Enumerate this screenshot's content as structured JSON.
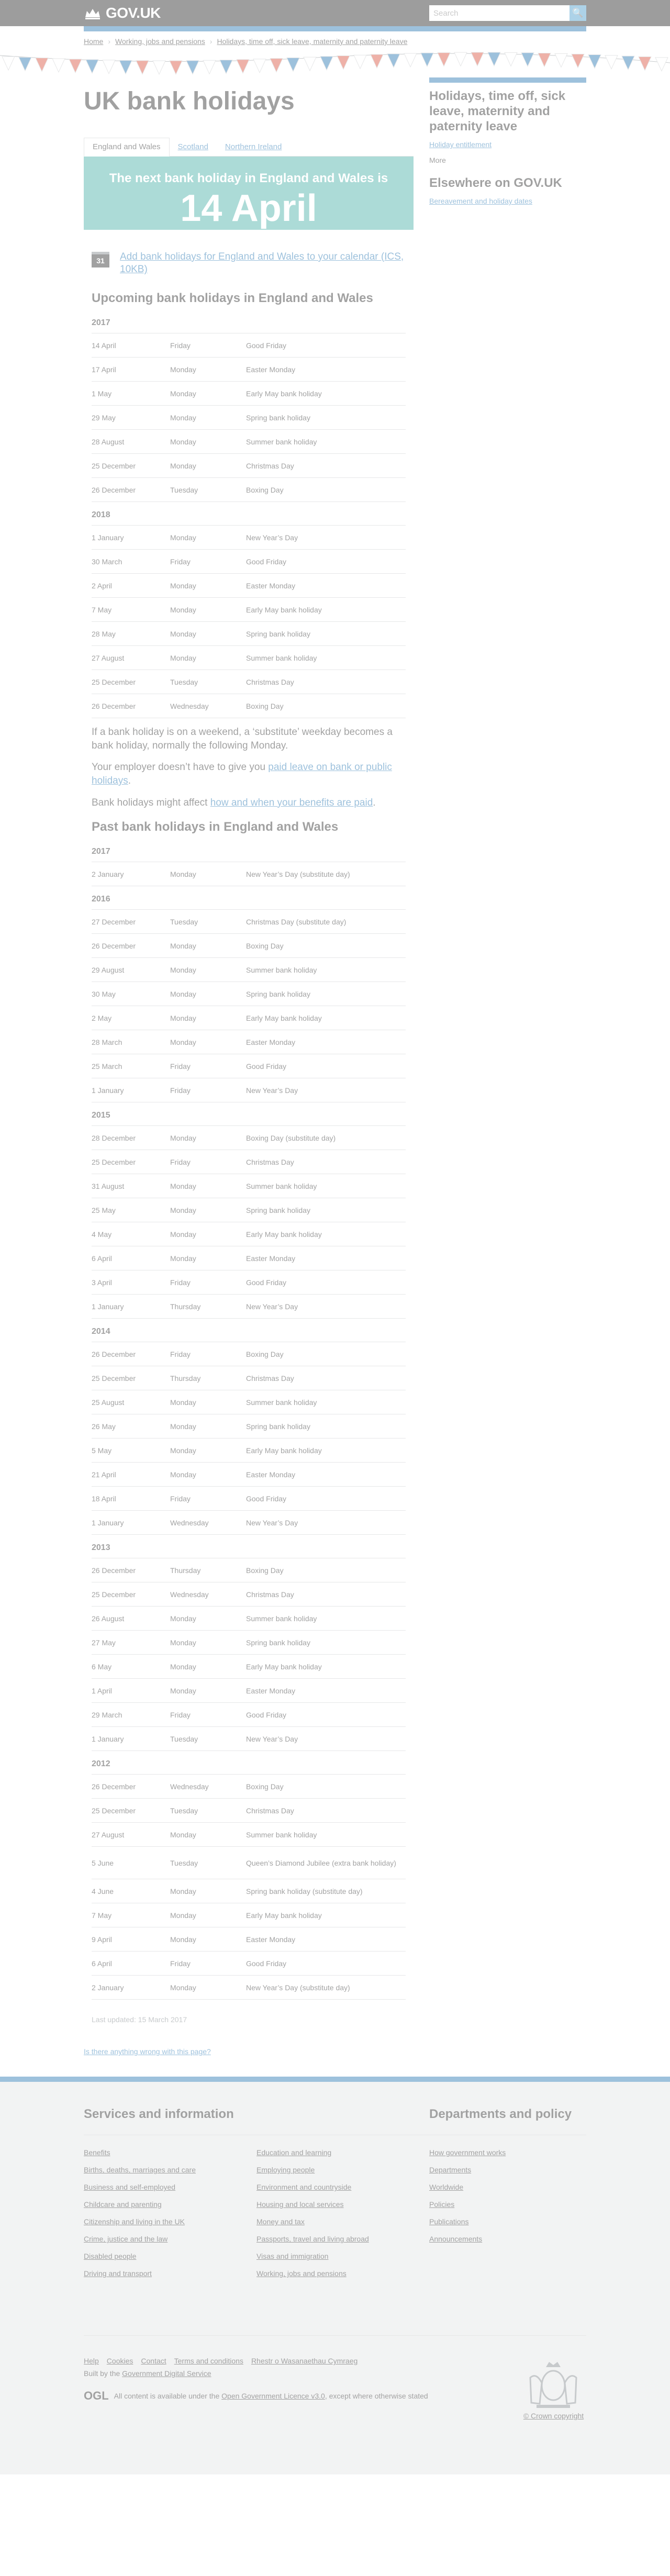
{
  "header": {
    "logo_text": "GOV.UK",
    "search_placeholder": "Search",
    "search_button": "🔍"
  },
  "breadcrumbs": [
    "Home",
    "Working, jobs and pensions",
    "Holidays, time off, sick leave, maternity and paternity leave"
  ],
  "page_title": "UK bank holidays",
  "tabs": [
    {
      "label": "England and Wales",
      "active": true
    },
    {
      "label": "Scotland",
      "active": false
    },
    {
      "label": "Northern Ireland",
      "active": false
    }
  ],
  "next_holiday": {
    "intro": "The next bank holiday in England and Wales is",
    "date": "14 April",
    "name": "Good Friday"
  },
  "calendar_icon_text": "31",
  "calendar_link": "Add bank holidays for England and Wales to your calendar (ICS, 10KB)",
  "upcoming_heading": "Upcoming bank holidays in England and Wales",
  "upcoming": [
    {
      "year": "2017",
      "rows": [
        [
          "14 April",
          "Friday",
          "Good Friday"
        ],
        [
          "17 April",
          "Monday",
          "Easter Monday"
        ],
        [
          "1 May",
          "Monday",
          "Early May bank holiday"
        ],
        [
          "29 May",
          "Monday",
          "Spring bank holiday"
        ],
        [
          "28 August",
          "Monday",
          "Summer bank holiday"
        ],
        [
          "25 December",
          "Monday",
          "Christmas Day"
        ],
        [
          "26 December",
          "Tuesday",
          "Boxing Day"
        ]
      ]
    },
    {
      "year": "2018",
      "rows": [
        [
          "1 January",
          "Monday",
          "New Year’s Day"
        ],
        [
          "30 March",
          "Friday",
          "Good Friday"
        ],
        [
          "2 April",
          "Monday",
          "Easter Monday"
        ],
        [
          "7 May",
          "Monday",
          "Early May bank holiday"
        ],
        [
          "28 May",
          "Monday",
          "Spring bank holiday"
        ],
        [
          "27 August",
          "Monday",
          "Summer bank holiday"
        ],
        [
          "25 December",
          "Tuesday",
          "Christmas Day"
        ],
        [
          "26 December",
          "Wednesday",
          "Boxing Day"
        ]
      ]
    }
  ],
  "notes": {
    "weekend": "If a bank holiday is on a weekend, a ‘substitute’ weekday becomes a bank holiday, normally the following Monday.",
    "employer_prefix": "Your employer doesn’t have to give you ",
    "employer_link": "paid leave on bank or public holidays",
    "employer_suffix": ".",
    "benefits_prefix": "Bank holidays might affect ",
    "benefits_link": "how and when your benefits are paid",
    "benefits_suffix": "."
  },
  "past_heading": "Past bank holidays in England and Wales",
  "past": [
    {
      "year": "2017",
      "rows": [
        [
          "2 January",
          "Monday",
          "New Year’s Day (substitute day)"
        ]
      ]
    },
    {
      "year": "2016",
      "rows": [
        [
          "27 December",
          "Tuesday",
          "Christmas Day (substitute day)"
        ],
        [
          "26 December",
          "Monday",
          "Boxing Day"
        ],
        [
          "29 August",
          "Monday",
          "Summer bank holiday"
        ],
        [
          "30 May",
          "Monday",
          "Spring bank holiday"
        ],
        [
          "2 May",
          "Monday",
          "Early May bank holiday"
        ],
        [
          "28 March",
          "Monday",
          "Easter Monday"
        ],
        [
          "25 March",
          "Friday",
          "Good Friday"
        ],
        [
          "1 January",
          "Friday",
          "New Year’s Day"
        ]
      ]
    },
    {
      "year": "2015",
      "rows": [
        [
          "28 December",
          "Monday",
          "Boxing Day (substitute day)"
        ],
        [
          "25 December",
          "Friday",
          "Christmas Day"
        ],
        [
          "31 August",
          "Monday",
          "Summer bank holiday"
        ],
        [
          "25 May",
          "Monday",
          "Spring bank holiday"
        ],
        [
          "4 May",
          "Monday",
          "Early May bank holiday"
        ],
        [
          "6 April",
          "Monday",
          "Easter Monday"
        ],
        [
          "3 April",
          "Friday",
          "Good Friday"
        ],
        [
          "1 January",
          "Thursday",
          "New Year’s Day"
        ]
      ]
    },
    {
      "year": "2014",
      "rows": [
        [
          "26 December",
          "Friday",
          "Boxing Day"
        ],
        [
          "25 December",
          "Thursday",
          "Christmas Day"
        ],
        [
          "25 August",
          "Monday",
          "Summer bank holiday"
        ],
        [
          "26 May",
          "Monday",
          "Spring bank holiday"
        ],
        [
          "5 May",
          "Monday",
          "Early May bank holiday"
        ],
        [
          "21 April",
          "Monday",
          "Easter Monday"
        ],
        [
          "18 April",
          "Friday",
          "Good Friday"
        ],
        [
          "1 January",
          "Wednesday",
          "New Year’s Day"
        ]
      ]
    },
    {
      "year": "2013",
      "rows": [
        [
          "26 December",
          "Thursday",
          "Boxing Day"
        ],
        [
          "25 December",
          "Wednesday",
          "Christmas Day"
        ],
        [
          "26 August",
          "Monday",
          "Summer bank holiday"
        ],
        [
          "27 May",
          "Monday",
          "Spring bank holiday"
        ],
        [
          "6 May",
          "Monday",
          "Early May bank holiday"
        ],
        [
          "1 April",
          "Monday",
          "Easter Monday"
        ],
        [
          "29 March",
          "Friday",
          "Good Friday"
        ],
        [
          "1 January",
          "Tuesday",
          "New Year’s Day"
        ]
      ]
    },
    {
      "year": "2012",
      "rows": [
        [
          "26 December",
          "Wednesday",
          "Boxing Day"
        ],
        [
          "25 December",
          "Tuesday",
          "Christmas Day"
        ],
        [
          "27 August",
          "Monday",
          "Summer bank holiday"
        ],
        [
          "5 June",
          "Tuesday",
          "Queen’s Diamond Jubilee (extra bank holiday)"
        ],
        [
          "4 June",
          "Monday",
          "Spring bank holiday (substitute day)"
        ],
        [
          "7 May",
          "Monday",
          "Early May bank holiday"
        ],
        [
          "9 April",
          "Monday",
          "Easter Monday"
        ],
        [
          "6 April",
          "Friday",
          "Good Friday"
        ],
        [
          "2 January",
          "Monday",
          "New Year’s Day (substitute day)"
        ]
      ]
    }
  ],
  "last_updated": "Last updated: 15 March 2017",
  "report_link": "Is there anything wrong with this page?",
  "sidebar": {
    "related_title": "Holidays, time off, sick leave, maternity and paternity leave",
    "related_links": [
      "Holiday entitlement"
    ],
    "more": "More",
    "elsewhere_title": "Elsewhere on GOV.UK",
    "elsewhere_links": [
      "Bereavement and holiday dates"
    ]
  },
  "footer": {
    "services_heading": "Services and information",
    "services": [
      "Benefits",
      "Education and learning",
      "Births, deaths, marriages and care",
      "Employing people",
      "Business and self-employed",
      "Environment and countryside",
      "Childcare and parenting",
      "Housing and local services",
      "Citizenship and living in the UK",
      "Money and tax",
      "Crime, justice and the law",
      "Passports, travel and living abroad",
      "Disabled people",
      "Visas and immigration",
      "Driving and transport",
      "Working, jobs and pensions"
    ],
    "departments_heading": "Departments and policy",
    "departments": [
      "How government works",
      "Departments",
      "Worldwide",
      "Policies",
      "Publications",
      "Announcements"
    ],
    "meta_links": [
      "Help",
      "Cookies",
      "Contact",
      "Terms and conditions",
      "Rhestr o Wasanaethau Cymraeg"
    ],
    "built_by_prefix": "Built by the ",
    "built_by_link": "Government Digital Service",
    "ogl_text": "OGL",
    "licence_prefix": "All content is available under the ",
    "licence_link": "Open Government Licence v3.0",
    "licence_suffix": ", except where otherwise stated",
    "copyright": "© Crown copyright"
  }
}
